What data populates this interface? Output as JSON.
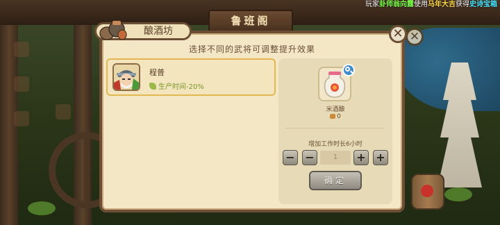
{
  "announcement": {
    "prefix": "玩家",
    "player": "卦师翁向露",
    "verb": "使用",
    "item_used": "马年大吉",
    "result_verb": "获得",
    "reward": "史诗宝箱"
  },
  "building_sign": "鲁班阁",
  "dialog": {
    "title": "酿酒坊",
    "subtitle": "选择不同的武将可调整提升效果",
    "close_symbol": "✕",
    "general": {
      "name": "程普",
      "effect": "生产时间-20%"
    },
    "item": {
      "name": "米酒酿",
      "count": "0"
    },
    "hours_label": "增加工作时长6小时",
    "stepper": {
      "min_symbol": "−",
      "minus_symbol": "−",
      "value": "1",
      "plus_symbol": "+",
      "max_symbol": "+"
    },
    "confirm_label": "确定"
  },
  "colors": {
    "panel_bg": "#f3e7c6",
    "border": "#6b4e34",
    "selected_border": "#e2b752",
    "effect_green": "#7b9a2a",
    "button_gray": "#908b80"
  }
}
